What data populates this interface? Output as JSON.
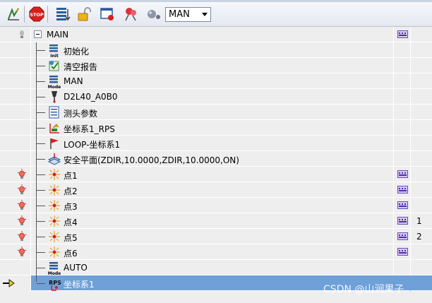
{
  "toolbar": {
    "buttons": [
      {
        "name": "edit-icon"
      },
      {
        "name": "stop-icon",
        "label": "STOP"
      },
      {
        "name": "list-mode-icon"
      },
      {
        "name": "unlock-icon"
      },
      {
        "name": "window-record-icon"
      },
      {
        "name": "pin-remove-icon"
      },
      {
        "name": "probe-icon"
      }
    ],
    "mode_value": "MAN"
  },
  "tree": {
    "root_label": "MAIN",
    "nodes": [
      {
        "label": "初始化",
        "icon": "init-icon",
        "icon_text": "Init"
      },
      {
        "label": "清空报告",
        "icon": "clear-report-icon"
      },
      {
        "label": "MAN",
        "icon": "mode-icon",
        "icon_text": "Mode"
      },
      {
        "label": "D2L40_A0B0",
        "icon": "probe-tip-icon"
      },
      {
        "label": "测头参数",
        "icon": "probe-params-icon"
      },
      {
        "label": "坐标系1_RPS",
        "icon": "coordinate-system-icon"
      },
      {
        "label": "LOOP-坐标系1",
        "icon": "flag-icon"
      },
      {
        "label": "安全平面(ZDIR,10.0000,ZDIR,10.0000,ON)",
        "icon": "safety-plane-icon"
      },
      {
        "label": "点1",
        "icon": "point-icon",
        "gutter": "bulb-icon",
        "param": true,
        "count": ""
      },
      {
        "label": "点2",
        "icon": "point-icon",
        "gutter": "bulb-icon",
        "param": true,
        "count": ""
      },
      {
        "label": "点3",
        "icon": "point-icon",
        "gutter": "bulb-icon",
        "param": true,
        "count": ""
      },
      {
        "label": "点4",
        "icon": "point-icon",
        "gutter": "bulb-icon",
        "param": true,
        "count": "1"
      },
      {
        "label": "点5",
        "icon": "point-icon",
        "gutter": "bulb-icon",
        "param": true,
        "count": "2"
      },
      {
        "label": "点6",
        "icon": "point-icon",
        "gutter": "bulb-icon",
        "param": true,
        "count": ""
      },
      {
        "label": "AUTO",
        "icon": "mode-icon",
        "icon_text": "Mode"
      },
      {
        "label": "坐标系1",
        "icon": "rps-icon",
        "icon_text": "RPS",
        "selected": true,
        "gutter": "current-arrow-icon"
      }
    ]
  },
  "watermark": "CSDN @山涧果子",
  "colors": {
    "selection": "#6fa0d8",
    "row_background": "#eeeeee",
    "toolbar_gradient_top": "#f7f9fc",
    "toolbar_gradient_bottom": "#e4e8ef"
  }
}
